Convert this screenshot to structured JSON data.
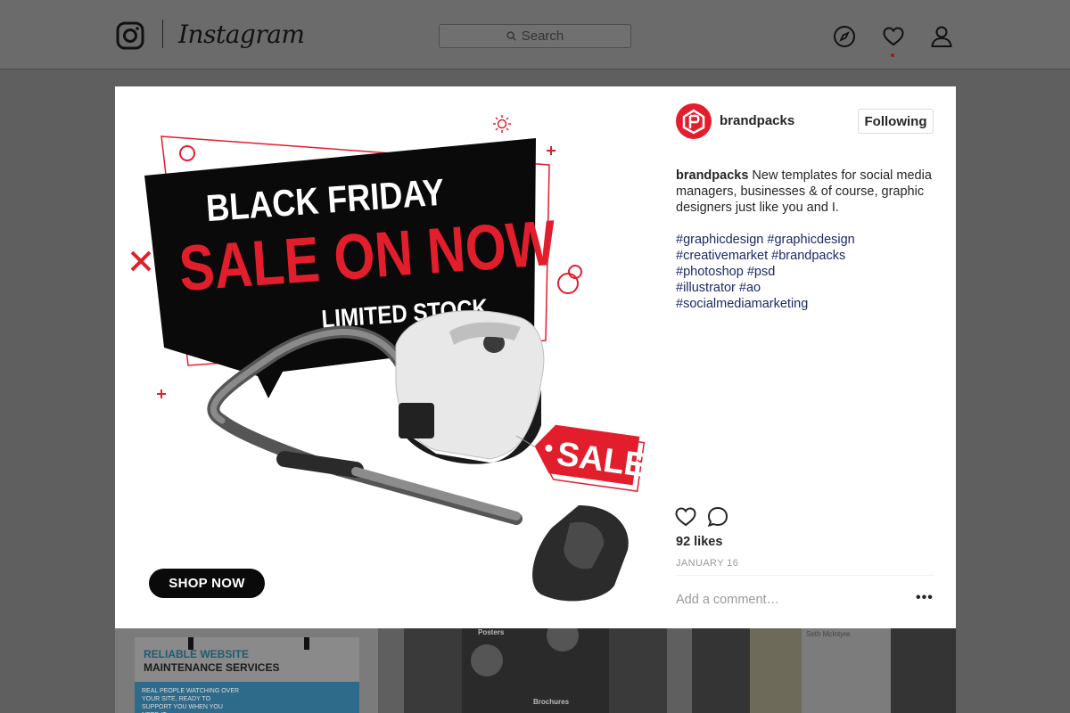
{
  "header": {
    "app_name": "Instagram",
    "search_placeholder": "Search",
    "icons": [
      "instagram-glyph-icon",
      "compass-icon",
      "heart-icon",
      "profile-icon"
    ]
  },
  "post": {
    "graphic": {
      "line1": "BLACK FRIDAY",
      "line2": "SALE ON NOW",
      "line3": "LIMITED STOCK",
      "tag": "SALE",
      "button": "SHOP NOW",
      "accent_color": "#e31e2c"
    },
    "username": "brandpacks",
    "follow_label": "Following",
    "caption_user": "brandpacks",
    "caption_text": " New templates for social media managers, businesses & of course, graphic designers just like you and I.",
    "hashtags": [
      "#graphicdesign #graphicdesign",
      "#creativemarket #brandpacks",
      "#photoshop #psd",
      "#illustrator #ao",
      "#socialmediamarketing"
    ],
    "likes": "92 likes",
    "date": "JANUARY 16",
    "comment_placeholder": "Add a comment…",
    "more": "•••"
  },
  "background_thumbs": {
    "thumb1_line1": "RELIABLE WEBSITE",
    "thumb1_line2": "MAINTENANCE SERVICES",
    "thumb1_small": "REAL PEOPLE WATCHING OVER YOUR SITE, READY TO SUPPORT YOU WHEN YOU NEED IT",
    "thumb2_label1": "Posters",
    "thumb2_label2": "Brochures",
    "thumb3_name": "Seth McIntyre"
  }
}
